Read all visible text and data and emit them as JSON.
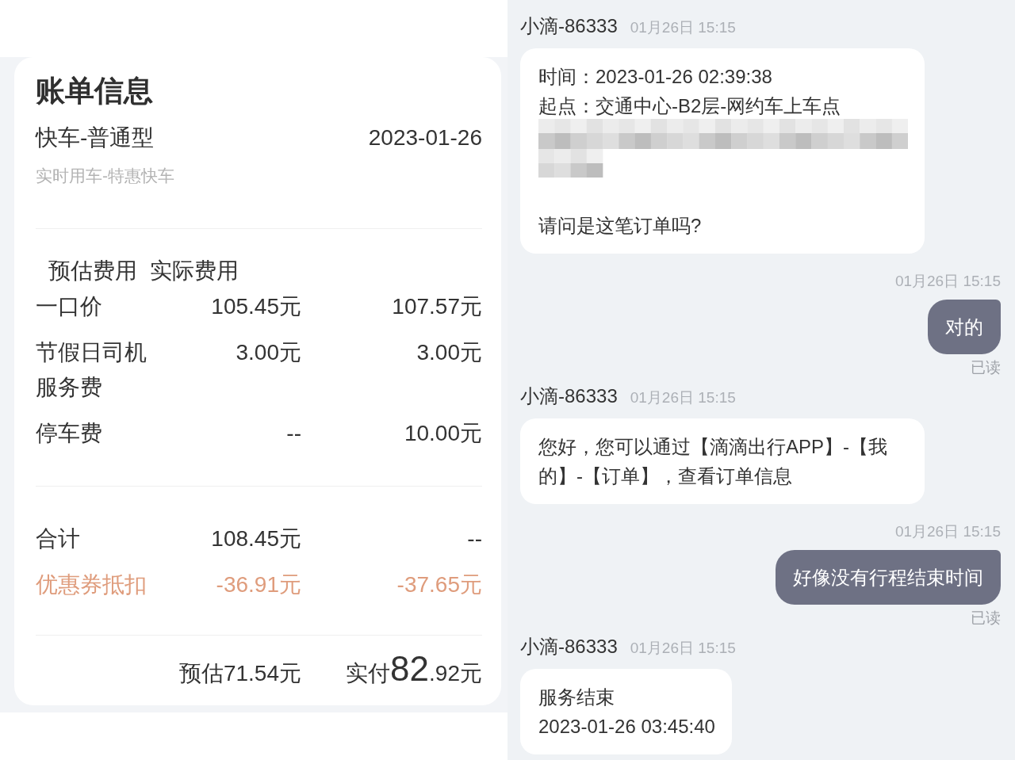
{
  "bill": {
    "title": "账单信息",
    "ride_type": "快车-普通型",
    "date": "2023-01-26",
    "service": "实时用车-特惠快车",
    "columns": [
      "预估费用",
      "实际费用"
    ],
    "sections": [
      {
        "rows": [
          {
            "kind": "fee",
            "label": "一口价",
            "estimated": "105.45元",
            "actual": "107.57元"
          },
          {
            "kind": "fee",
            "label": "节假日司机服务费",
            "estimated": "3.00元",
            "actual": "3.00元"
          },
          {
            "kind": "fee",
            "label": "停车费",
            "estimated": "--",
            "actual": "10.00元"
          }
        ]
      },
      {
        "rows": [
          {
            "kind": "total",
            "label": "合计",
            "estimated": "108.45元",
            "actual": "--"
          },
          {
            "kind": "discount",
            "label": "优惠券抵扣",
            "estimated": "-36.91元",
            "actual": "-37.65元"
          }
        ]
      }
    ],
    "footer": {
      "estimate": "预估71.54元",
      "paid": {
        "label": "实付",
        "amount_major": "82",
        "amount_minor": ".92元"
      }
    }
  },
  "chat": {
    "messages": [
      {
        "kind": "incoming",
        "sender": "小滴-86333",
        "time": "01月26日 15:15",
        "lines": [
          {
            "kind": "text",
            "text": "时间：2023-01-26 02:39:38"
          },
          {
            "kind": "text",
            "text": "起点：交通中心-B2层-网约车上车点"
          },
          {
            "kind": "redacted"
          },
          {
            "kind": "text",
            "text": "请问是这笔订单吗?"
          }
        ]
      },
      {
        "kind": "outgoing",
        "time": "01月26日 15:15",
        "lines": [
          {
            "kind": "text",
            "text": "对的"
          }
        ],
        "status": "已读"
      },
      {
        "kind": "incoming",
        "sender": "小滴-86333",
        "time": "01月26日 15:15",
        "lines": [
          {
            "kind": "text",
            "text": "您好，您可以通过【滴滴出行APP】-【我的】-【订单】，查看订单信息"
          }
        ]
      },
      {
        "kind": "outgoing",
        "time": "01月26日 15:15",
        "lines": [
          {
            "kind": "text",
            "text": "好像没有行程结束时间"
          }
        ],
        "status": "已读"
      },
      {
        "kind": "incoming",
        "sender": "小滴-86333",
        "time": "01月26日 15:15",
        "lines": [
          {
            "kind": "text",
            "text": "服务结束"
          },
          {
            "kind": "text",
            "text": "2023-01-26 03:45:40"
          }
        ]
      }
    ]
  }
}
